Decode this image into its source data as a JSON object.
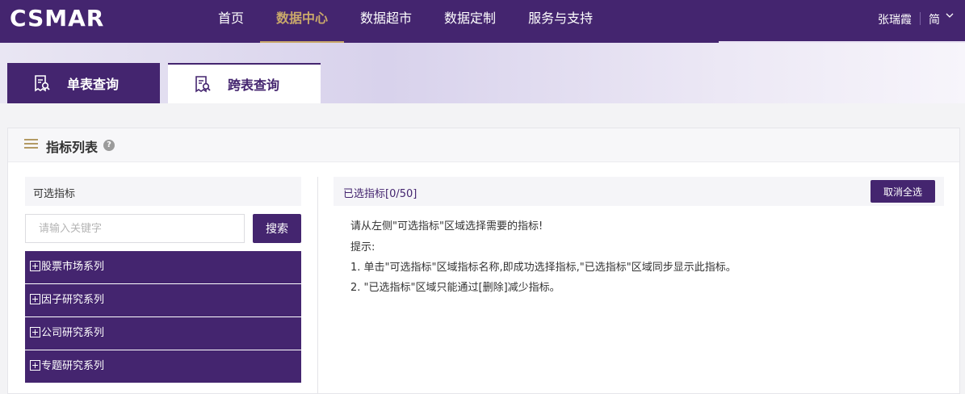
{
  "header": {
    "logo": "CSMAR",
    "nav": [
      {
        "label": "首页",
        "active": false
      },
      {
        "label": "数据中心",
        "active": true
      },
      {
        "label": "数据超市",
        "active": false
      },
      {
        "label": "数据定制",
        "active": false
      },
      {
        "label": "服务与支持",
        "active": false
      }
    ],
    "user_name": "张瑞霞",
    "language": "简"
  },
  "tabs": [
    {
      "label": "单表查询",
      "active": false
    },
    {
      "label": "跨表查询",
      "active": true
    }
  ],
  "panel": {
    "title": "指标列表",
    "help_icon": "?"
  },
  "left": {
    "title": "可选指标",
    "search_placeholder": "请输入关键字",
    "search_label": "搜索",
    "series": [
      "股票市场系列",
      "因子研究系列",
      "公司研究系列",
      "专题研究系列"
    ]
  },
  "right": {
    "title": "已选指标[0/50]",
    "clear_label": "取消全选",
    "hints": [
      "请从左侧\"可选指标\"区域选择需要的指标!",
      "提示:",
      "1. 单击\"可选指标\"区域指标名称,即成功选择指标,\"已选指标\"区域同步显示此指标。",
      "2. \"已选指标\"区域只能通过[删除]减少指标。"
    ]
  },
  "colors": {
    "brand": "#44256f",
    "accent": "#c9a86a"
  }
}
